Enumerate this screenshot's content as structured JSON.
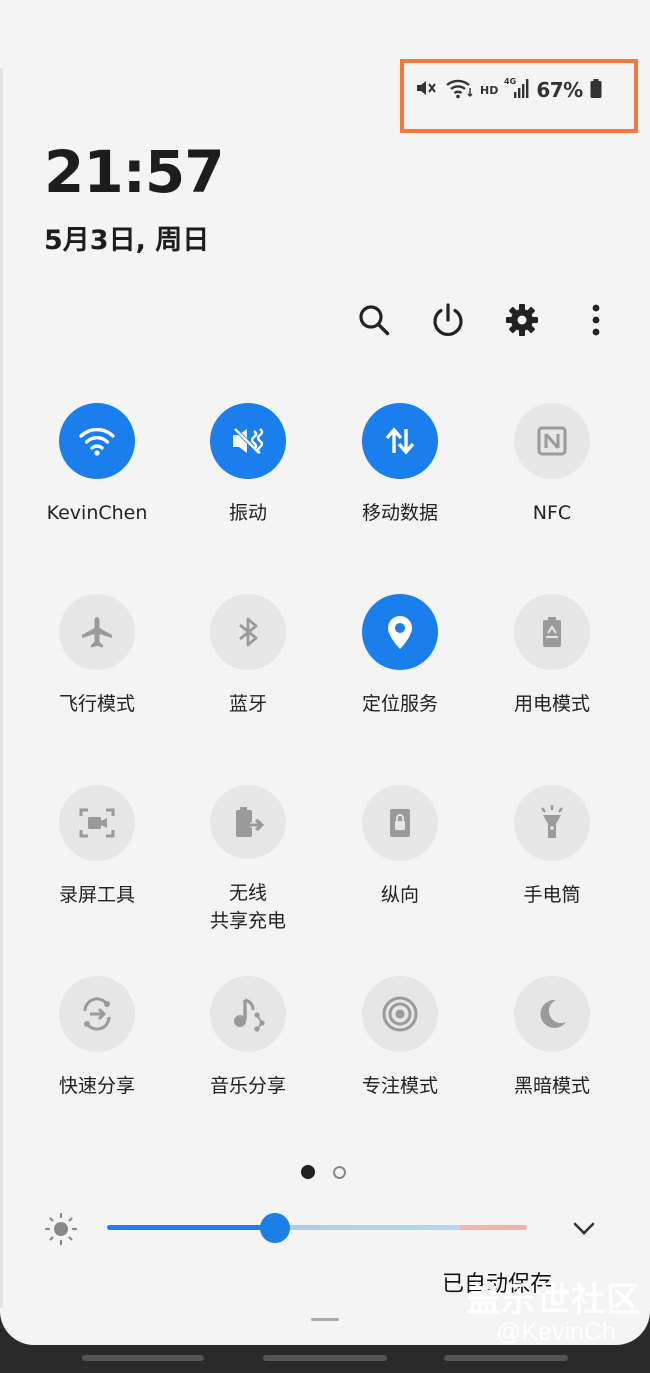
{
  "status_bar": {
    "icons": [
      "mute-icon",
      "wifi-icon",
      "signal-icon",
      "battery-icon"
    ],
    "hd_label": "HD",
    "network_label": "4G",
    "battery": "67%"
  },
  "clock": {
    "time": "21:57",
    "date": "5月3日, 周日"
  },
  "toolbar": [
    "search-icon",
    "power-icon",
    "settings-icon",
    "more-icon"
  ],
  "tiles": [
    {
      "label": "KevinChen",
      "icon": "wifi-icon",
      "on": true
    },
    {
      "label": "振动",
      "icon": "vibrate-icon",
      "on": true
    },
    {
      "label": "移动数据",
      "icon": "mobile-data-icon",
      "on": true
    },
    {
      "label": "NFC",
      "icon": "nfc-icon",
      "on": false
    },
    {
      "label": "飞行模式",
      "icon": "airplane-icon",
      "on": false
    },
    {
      "label": "蓝牙",
      "icon": "bluetooth-icon",
      "on": false
    },
    {
      "label": "定位服务",
      "icon": "location-icon",
      "on": true
    },
    {
      "label": "用电模式",
      "icon": "battery-saver-icon",
      "on": false
    },
    {
      "label": "录屏工具",
      "icon": "screen-recorder-icon",
      "on": false
    },
    {
      "label": "无线\n共享充电",
      "icon": "wireless-powershare-icon",
      "on": false
    },
    {
      "label": "纵向",
      "icon": "portrait-lock-icon",
      "on": false
    },
    {
      "label": "手电筒",
      "icon": "flashlight-icon",
      "on": false
    },
    {
      "label": "快速分享",
      "icon": "quick-share-icon",
      "on": false
    },
    {
      "label": "音乐分享",
      "icon": "music-share-icon",
      "on": false
    },
    {
      "label": "专注模式",
      "icon": "focus-mode-icon",
      "on": false
    },
    {
      "label": "黑暗模式",
      "icon": "dark-mode-icon",
      "on": false
    }
  ],
  "pager": {
    "pages": 2,
    "current": 1
  },
  "brightness": {
    "level": 0.4
  },
  "footer": {
    "text": "已自动保存",
    "watermark": "盖乐世社区",
    "watermark_handle": "@KevinCh"
  },
  "colors": {
    "accent": "#1a7fed",
    "tile_off": "#e6e6e6",
    "status_highlight": "#f07a3a"
  }
}
